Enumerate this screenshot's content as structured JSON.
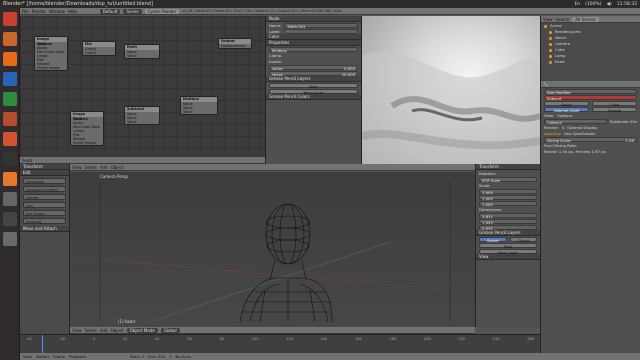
{
  "window": {
    "title": "Blender* [/home/blender/Downloads/dsp_tut/untitled.blend]",
    "clock": "11:58:33",
    "indicators": [
      "En",
      "(100%)",
      "◀)"
    ]
  },
  "launcher": {
    "icons": [
      "ubuntu-dash-icon",
      "files-icon",
      "firefox-icon",
      "libreoffice-writer-icon",
      "libreoffice-calc-icon",
      "libreoffice-impress-icon",
      "software-center-icon",
      "terminal-icon",
      "blender-icon",
      "settings-icon",
      "monitor-icon",
      "trash-icon"
    ],
    "colors": [
      "#c8412f",
      "#c8692b",
      "#e66a1b",
      "#2b64b6",
      "#2f8c3f",
      "#b54d2f",
      "#d2552e",
      "#333333",
      "#e8772e",
      "#666666",
      "#444444",
      "#6a6a6a"
    ]
  },
  "top_header": {
    "menus": [
      "File",
      "Render",
      "Window",
      "Help"
    ],
    "screen": "Default",
    "scene": "Scene",
    "engine": "Cycles Render",
    "stats": "v2.76 | Verts:69 | Faces:42 | Tris:1,736 | Objects:1/1 | Lamps:0/1 | Mem:473.64 MB | bust"
  },
  "node_editor": {
    "nodes": [
      {
        "title": "Image Texture",
        "rows": [
          "Color",
          "Alpha",
          "Non-Color Data",
          "Linear",
          "Flat",
          "Repeat",
          "Single Image"
        ]
      },
      {
        "title": "Mix",
        "rows": [
          "Color1",
          "Color2"
        ]
      },
      {
        "title": "Math",
        "rows": [
          "Value",
          "Value"
        ]
      },
      {
        "title": "Image Texture",
        "rows": [
          "Color",
          "Alpha",
          "Non-Color Data",
          "Linear",
          "Flat",
          "Repeat",
          "Single Image"
        ]
      },
      {
        "title": "Subtract",
        "rows": [
          "Value",
          "Value",
          "Value"
        ]
      },
      {
        "title": "Multiply",
        "rows": [
          "Value",
          "Value",
          "Value"
        ]
      },
      {
        "title": "Output",
        "rows": [
          "Displacement"
        ]
      }
    ],
    "footer_label": "head"
  },
  "node_props": {
    "header": "Node",
    "name_label": "Name:",
    "name_value": "Math.001",
    "label_label": "Label:",
    "color_section": "Color",
    "properties_section": "Properties",
    "operation": "Multiply",
    "clamp": "Clamp",
    "inputs_label": "Inputs:",
    "value1_label": "Value:",
    "value1": "0.500",
    "value2_label": "Value:",
    "value2": "10.000",
    "grease_section": "Grease Pencil Layers",
    "new_button": "New",
    "new_layer_button": "New Layer",
    "grease_colors": "Grease Pencil Colors"
  },
  "outliner": {
    "header_view": "View",
    "header_search": "Search",
    "header_scenes": "All Scenes",
    "items": [
      "Scene",
      "RenderLayers",
      "World",
      "Camera",
      "Cube",
      "Lamp",
      "head"
    ]
  },
  "modifier_panel": {
    "tabs": [
      "Add Modifier"
    ],
    "modifier_name": "Subsurf",
    "apply": "Apply",
    "copy": "Copy",
    "mode_catmull": "Catmull-Clark",
    "mode_simple": "Simple",
    "view_label": "View:",
    "view_mode": "Catmull",
    "render_label": "Render:",
    "render_value": "4",
    "adaptive": "Adaptive",
    "dicing_label": "Dicing Scale:",
    "dicing_value": "1.00",
    "options_label": "Options:",
    "opt1": "Subdivide UVs",
    "opt2": "Optimal Display",
    "opt3": "Use OpenSubdiv",
    "final_scale": "Final Dicing Rate:",
    "render_rate": "Render 1.00 px, Preview 1.67 px"
  },
  "tool_shelf": {
    "transform_header": "Transform",
    "edit_header": "Edit",
    "buttons": [
      "Duplicate",
      "Duplicate Linked",
      "Delete",
      "Join",
      "Set Origin",
      "Shading"
    ],
    "history_header": "Move and Attach"
  },
  "viewport": {
    "view_label": "Camera Persp",
    "object_label": "(1) head",
    "menus": [
      "View",
      "Select",
      "Add",
      "Object"
    ],
    "mode": "Object Mode",
    "shading": "Global",
    "layer_label": "Layers"
  },
  "n_panel": {
    "header": "Transform",
    "location_label": "Location:",
    "rotation_label": "Rotation:",
    "scale_label": "Scale:",
    "dimensions_label": "Dimensions:",
    "dim_x": "1.811",
    "dim_y": "1.443",
    "dim_z": "2.032",
    "rot_mode": "XYZ Euler",
    "scale_x": "1.000",
    "scale_y": "1.000",
    "scale_z": "1.000",
    "grease_section": "Grease Pencil Layers",
    "scene_tab": "Scene",
    "object_tab": "Object",
    "new_button": "New",
    "new_layer": "New Layer",
    "view_section": "View"
  },
  "timeline": {
    "ticks": [
      "-40",
      "-20",
      "0",
      "20",
      "40",
      "60",
      "80",
      "100",
      "120",
      "140",
      "160",
      "180",
      "200",
      "220",
      "240",
      "260"
    ],
    "start_label": "Start:",
    "start": "1",
    "end_label": "End:",
    "end": "250",
    "current": "1",
    "sync": "No Sync",
    "menus": [
      "View",
      "Marker",
      "Frame",
      "Playback"
    ]
  }
}
